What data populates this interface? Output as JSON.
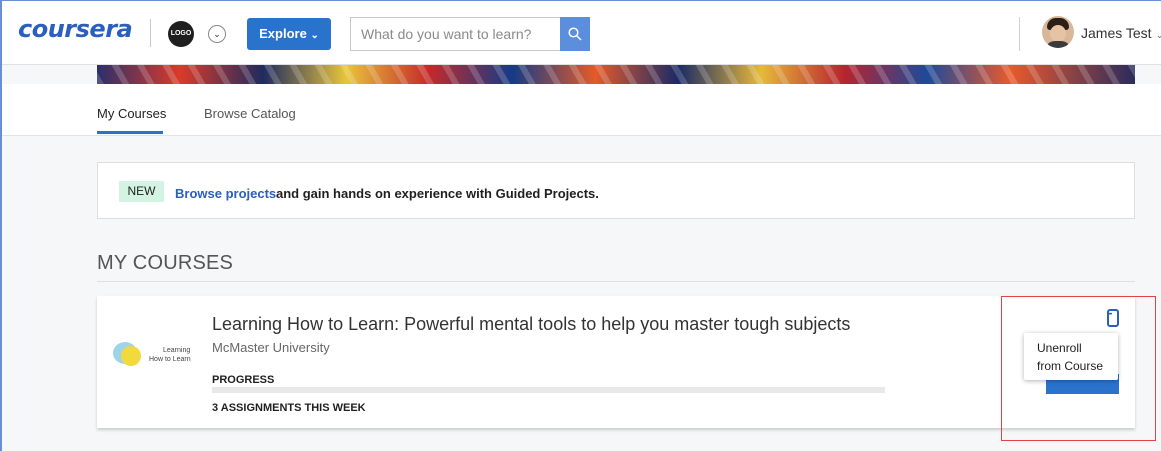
{
  "header": {
    "logo_text": "coursera",
    "org_logo_text": "LOGO",
    "explore_label": "Explore",
    "search_placeholder": "What do you want to learn?",
    "user_name": "James Test"
  },
  "tabs": [
    {
      "label": "My Courses",
      "active": true
    },
    {
      "label": "Browse Catalog",
      "active": false
    }
  ],
  "notice": {
    "badge": "NEW",
    "link_text": "Browse projects",
    "text": "and gain hands on experience with Guided Projects."
  },
  "section_title": "MY COURSES",
  "course": {
    "thumb_line1": "Learning",
    "thumb_line2": "How to Learn",
    "title": "Learning How to Learn: Powerful mental tools to help you master tough subjects",
    "university": "McMaster University",
    "progress_label": "PROGRESS",
    "progress_fraction": 0,
    "assignments_text": "3 ASSIGNMENTS THIS WEEK"
  },
  "menu_popup": {
    "line1": "Unenroll",
    "line2": "from Course"
  },
  "colors": {
    "brand": "#2a5fbd",
    "button": "#2a73cc",
    "new_badge": "#d4f4e3",
    "highlight": "#e04343"
  },
  "icons": {
    "search": "search-icon",
    "chevron": "chevron-down-icon",
    "more": "more-options-icon"
  }
}
